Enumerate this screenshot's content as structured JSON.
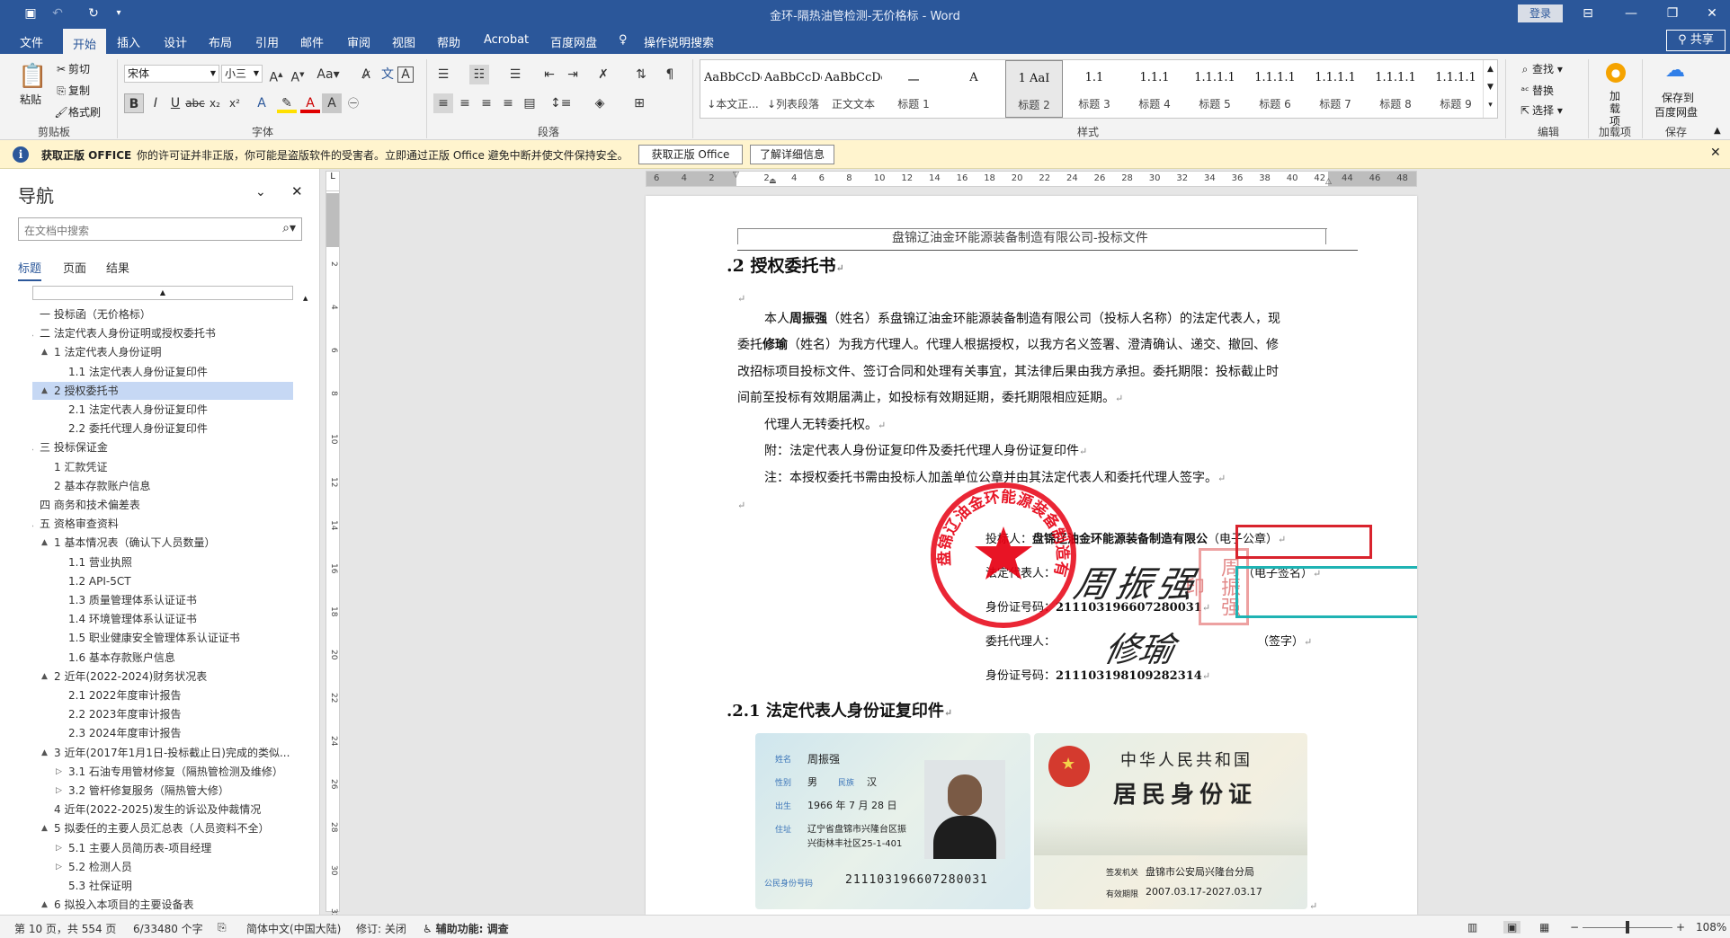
{
  "app": {
    "title": "金环-隔热油管检测-无价格标  -  Word",
    "login": "登录",
    "share": "共享"
  },
  "menu": {
    "tabs": [
      "文件",
      "开始",
      "插入",
      "设计",
      "布局",
      "引用",
      "邮件",
      "审阅",
      "视图",
      "帮助",
      "Acrobat",
      "百度网盘"
    ],
    "tell_me": "操作说明搜索"
  },
  "ribbon": {
    "clipboard": {
      "paste": "粘贴",
      "cut": "剪切",
      "copy": "复制",
      "format_painter": "格式刷",
      "label": "剪贴板"
    },
    "font": {
      "name": "宋体",
      "size": "小三",
      "label": "字体"
    },
    "paragraph": {
      "label": "段落"
    },
    "styles": {
      "label": "样式",
      "items": [
        {
          "preview": "AaBbCcDdI",
          "name": "↓本文正..."
        },
        {
          "preview": "AaBbCcDdI",
          "name": "↓列表段落"
        },
        {
          "preview": "AaBbCcDdI",
          "name": "正文文本"
        },
        {
          "preview": "一",
          "name": "标题 1"
        },
        {
          "preview": "A",
          "name": ""
        },
        {
          "preview": "1   AaI",
          "name": "标题 2"
        },
        {
          "preview": "1.1",
          "name": "标题 3"
        },
        {
          "preview": "1.1.1",
          "name": "标题 4"
        },
        {
          "preview": "1.1.1.1",
          "name": "标题 5"
        },
        {
          "preview": "1.1.1.1",
          "name": "标题 6"
        },
        {
          "preview": "1.1.1.1",
          "name": "标题 7"
        },
        {
          "preview": "1.1.1.1",
          "name": "标题 8"
        },
        {
          "preview": "1.1.1.1",
          "name": "标题 9"
        }
      ]
    },
    "editing": {
      "find": "查找",
      "replace": "替换",
      "select": "选择",
      "label": "编辑"
    },
    "addins": {
      "btn": "加载项",
      "label": "加载项"
    },
    "save": {
      "btn1": "保存到",
      "btn2": "百度网盘",
      "label": "保存"
    }
  },
  "msgbar": {
    "title": "获取正版 OFFICE",
    "text": "你的许可证并非正版，你可能是盗版软件的受害者。立即通过正版 Office 避免中断并使文件保持安全。",
    "btn1": "获取正版 Office",
    "btn2": "了解详细信息"
  },
  "nav": {
    "title": "导航",
    "search_placeholder": "在文档中搜索",
    "tabs": [
      "标题",
      "页面",
      "结果"
    ],
    "items": [
      {
        "t": "一 投标函（无价格标）",
        "lvl": 0,
        "exp": ""
      },
      {
        "t": "二 法定代表人身份证明或授权委托书",
        "lvl": 0,
        "exp": "▲"
      },
      {
        "t": "1 法定代表人身份证明",
        "lvl": 1,
        "exp": "▲"
      },
      {
        "t": "1.1 法定代表人身份证复印件",
        "lvl": 2,
        "exp": ""
      },
      {
        "t": "2 授权委托书",
        "lvl": 1,
        "exp": "▲",
        "sel": true
      },
      {
        "t": "2.1 法定代表人身份证复印件",
        "lvl": 2,
        "exp": ""
      },
      {
        "t": "2.2 委托代理人身份证复印件",
        "lvl": 2,
        "exp": ""
      },
      {
        "t": "三 投标保证金",
        "lvl": 0,
        "exp": "▲"
      },
      {
        "t": "1 汇款凭证",
        "lvl": 1,
        "exp": ""
      },
      {
        "t": "2 基本存款账户信息",
        "lvl": 1,
        "exp": ""
      },
      {
        "t": "四 商务和技术偏差表",
        "lvl": 0,
        "exp": ""
      },
      {
        "t": "五 资格审查资料",
        "lvl": 0,
        "exp": "▲"
      },
      {
        "t": "1 基本情况表（确认下人员数量）",
        "lvl": 1,
        "exp": "▲"
      },
      {
        "t": "1.1 营业执照",
        "lvl": 2,
        "exp": ""
      },
      {
        "t": "1.2 API-5CT",
        "lvl": 2,
        "exp": ""
      },
      {
        "t": "1.3 质量管理体系认证证书",
        "lvl": 2,
        "exp": ""
      },
      {
        "t": "1.4 环境管理体系认证证书",
        "lvl": 2,
        "exp": ""
      },
      {
        "t": "1.5 职业健康安全管理体系认证证书",
        "lvl": 2,
        "exp": ""
      },
      {
        "t": "1.6 基本存款账户信息",
        "lvl": 2,
        "exp": ""
      },
      {
        "t": "2 近年(2022-2024)财务状况表",
        "lvl": 1,
        "exp": "▲"
      },
      {
        "t": "2.1 2022年度审计报告",
        "lvl": 2,
        "exp": ""
      },
      {
        "t": "2.2 2023年度审计报告",
        "lvl": 2,
        "exp": ""
      },
      {
        "t": "2.3 2024年度审计报告",
        "lvl": 2,
        "exp": ""
      },
      {
        "t": "3 近年(2017年1月1日-投标截止日)完成的类似...",
        "lvl": 1,
        "exp": "▲"
      },
      {
        "t": "3.1 石油专用管材修复（隔热管检测及维修）",
        "lvl": 2,
        "exp": "▷"
      },
      {
        "t": "3.2 管杆修复服务（隔热管大修）",
        "lvl": 2,
        "exp": "▷"
      },
      {
        "t": "4 近年(2022-2025)发生的诉讼及仲裁情况",
        "lvl": 1,
        "exp": ""
      },
      {
        "t": "5 拟委任的主要人员汇总表（人员资料不全）",
        "lvl": 1,
        "exp": "▲"
      },
      {
        "t": "5.1 主要人员简历表-项目经理",
        "lvl": 2,
        "exp": "▷"
      },
      {
        "t": "5.2 检测人员",
        "lvl": 2,
        "exp": "▷"
      },
      {
        "t": "5.3 社保证明",
        "lvl": 2,
        "exp": ""
      },
      {
        "t": "6 拟投入本项目的主要设备表",
        "lvl": 1,
        "exp": "▲"
      }
    ]
  },
  "doc": {
    "header": "盘锦辽油金环能源装备制造有限公司-投标文件",
    "h1": ".2 授权委托书",
    "para1_pre": "本人",
    "para1_name": "周振强",
    "para1_a": "（姓名）系盘锦辽油金环能源装备制造有限公司（投标人名称）的法定代表人，现",
    "para1_b_pre": "委托",
    "para1_b_name": "修瑜",
    "para1_b": "（姓名）为我方代理人。代理人根据授权，以我方名义签署、澄清确认、递交、撤回、修",
    "para1_c": "改招标项目投标文件、签订合同和处理有关事宜，其法律后果由我方承担。委托期限：投标截止时",
    "para1_d": "间前至投标有效期届满止，如投标有效期延期，委托期限相应延期。",
    "line2": "代理人无转委托权。",
    "line3": "附：法定代表人身份证复印件及委托代理人身份证复印件",
    "line4": "注：本授权委托书需由投标人加盖单位公章并由其法定代表人和委托代理人签字。",
    "sig_bidder_label": "投标人：",
    "sig_bidder": "盘锦辽油金环能源装备制造有限公",
    "sig_bidder_suffix": "（电子公章）",
    "sig_legal_label": "法定代表人：",
    "sig_legal_suffix": "（电子签名）",
    "sig_id1_label": "身份证号码：",
    "sig_id1": "211103196607280031",
    "sig_agent_label": "委托代理人：",
    "sig_agent_suffix": "（签字）",
    "sig_id2_label": "身份证号码：",
    "sig_id2": "211103198109282314",
    "h2": ".2.1 法定代表人身份证复印件",
    "seal_text": "盘锦辽油金环能源装备制造有限公司",
    "seal_personal": "周振强印",
    "sign1": "周振强",
    "sign2": "修瑜",
    "idcard": {
      "name_l": "姓名",
      "name": "周振强",
      "sex_l": "性别",
      "sex": "男",
      "eth_l": "民族",
      "eth": "汉",
      "birth_l": "出生",
      "birth": "1966 年 7 月 28 日",
      "addr_l": "住址",
      "addr1": "辽宁省盘锦市兴隆台区振",
      "addr2": "兴街林丰社区25-1-401",
      "idno_l": "公民身份号码",
      "idno": "211103196607280031",
      "country": "中华人民共和国",
      "card_title": "居民身份证",
      "issuer_l": "签发机关",
      "issuer": "盘锦市公安局兴隆台分局",
      "valid_l": "有效期限",
      "valid": "2007.03.17-2027.03.17"
    }
  },
  "status": {
    "page": "第 10 页，共 554 页",
    "words": "6/33480 个字",
    "lang": "简体中文(中国大陆)",
    "track": "修订: 关闭",
    "access": "辅助功能: 调查",
    "zoom": "108%"
  },
  "colors": {
    "brand": "#2b579a",
    "red_box": "#d9232d",
    "cyan_box": "#1fb3b3",
    "seal": "#e60012"
  }
}
